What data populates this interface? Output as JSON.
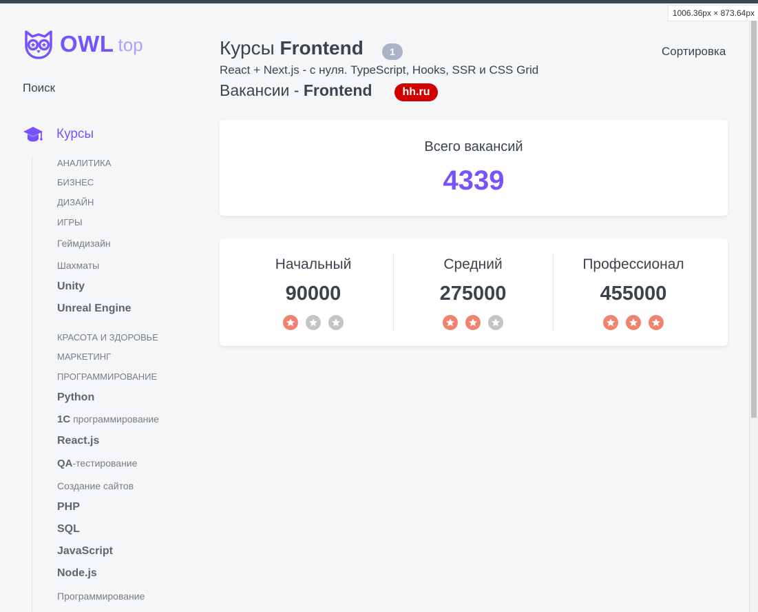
{
  "browser": {
    "viewport_size_label": "1006.36px × 873.64px"
  },
  "sidebar": {
    "logo": {
      "brand": "OWL",
      "suffix": "top"
    },
    "search_label": "Поиск",
    "menu_label": "Курсы",
    "items": [
      {
        "label": "АНАЛИТИКА"
      },
      {
        "label": "БИЗНЕС"
      },
      {
        "label": "ДИЗАЙН"
      },
      {
        "label": "ИГРЫ"
      },
      {
        "label": "Геймдизайн"
      },
      {
        "label": "Шахматы"
      },
      {
        "label": "Unity"
      },
      {
        "label": "Unreal Engine"
      },
      {
        "label": "КРАСОТА И ЗДОРОВЬЕ"
      },
      {
        "label": "МАРКЕТИНГ"
      },
      {
        "label": "ПРОГРАММИРОВАНИЕ"
      },
      {
        "label": "Python"
      },
      {
        "label_bold": "1С",
        "label_rest": " программирование"
      },
      {
        "label": "React.js"
      },
      {
        "label_bold": "QA",
        "label_rest": "-тестирование"
      },
      {
        "label": "Создание сайтов"
      },
      {
        "label": "PHP"
      },
      {
        "label": "SQL"
      },
      {
        "label": "JavaScript"
      },
      {
        "label": "Node.js"
      },
      {
        "label": "Программирование"
      }
    ]
  },
  "header": {
    "title_prefix": "Курсы",
    "title_main": "Frontend",
    "count": "1",
    "sort_label": "Сортировка",
    "subtitle": "React + Next.js - с нуля. TypeScript, Hooks, SSR и CSS Grid",
    "vacancies_prefix": "Вакансии -",
    "vacancies_main": "Frontend",
    "source_badge": "hh.ru"
  },
  "vacancies": {
    "total_label": "Всего вакансий",
    "total_value": "4339",
    "levels": [
      {
        "label": "Начальный",
        "value": "90000",
        "stars": 1,
        "max_stars": 3
      },
      {
        "label": "Средний",
        "value": "275000",
        "stars": 2,
        "max_stars": 3
      },
      {
        "label": "Профессионал",
        "value": "455000",
        "stars": 3,
        "max_stars": 3
      }
    ]
  },
  "colors": {
    "accent": "#7653fc",
    "star_active": "#f0826e",
    "star_inactive": "#c4c4c4",
    "hh_red": "#d10000",
    "count_badge": "#aab3c8"
  }
}
